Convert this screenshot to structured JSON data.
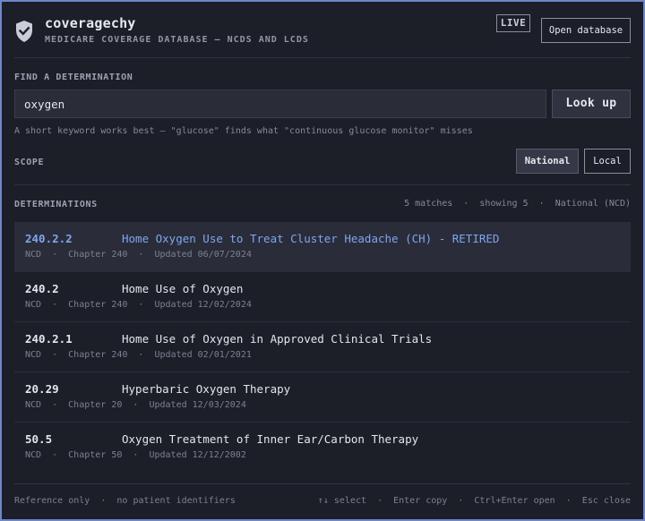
{
  "header": {
    "app_name": "coveragechy",
    "subtitle": "MEDICARE COVERAGE DATABASE — NCDS AND LCDS",
    "live_badge": "LIVE",
    "open_database_label": "Open database"
  },
  "search": {
    "section_label": "FIND A DETERMINATION",
    "query": "oxygen",
    "button_label": "Look up",
    "hint": "A short keyword works best — \"glucose\" finds what \"continuous glucose monitor\" misses"
  },
  "scope": {
    "label": "SCOPE",
    "options": [
      "National",
      "Local"
    ],
    "selected": "National"
  },
  "results": {
    "section_label": "DETERMINATIONS",
    "meta": "5 matches  ·  showing 5  ·  National (NCD)",
    "items": [
      {
        "id": "240.2.2",
        "title": "Home Oxygen Use to Treat Cluster Headache (CH) - RETIRED",
        "meta": "NCD  ·  Chapter 240  ·  Updated 06/07/2024",
        "selected": true
      },
      {
        "id": "240.2",
        "title": "Home Use of Oxygen",
        "meta": "NCD  ·  Chapter 240  ·  Updated 12/02/2024",
        "selected": false
      },
      {
        "id": "240.2.1",
        "title": "Home Use of Oxygen in Approved Clinical Trials",
        "meta": "NCD  ·  Chapter 240  ·  Updated 02/01/2021",
        "selected": false
      },
      {
        "id": "20.29",
        "title": "Hyperbaric Oxygen Therapy",
        "meta": "NCD  ·  Chapter 20  ·  Updated 12/03/2024",
        "selected": false
      },
      {
        "id": "50.5",
        "title": "Oxygen Treatment of Inner Ear/Carbon Therapy",
        "meta": "NCD  ·  Chapter 50  ·  Updated 12/12/2002",
        "selected": false
      }
    ]
  },
  "footer": {
    "left": "Reference only  ·  no patient identifiers",
    "right": "↑↓ select  ·  Enter copy  ·  Ctrl+Enter open  ·  Esc close"
  },
  "colors": {
    "accent": "#7ea6ef",
    "frame_border": "#6f86c9",
    "background": "#1c1e28"
  },
  "icons": {
    "logo": "shield-check-icon"
  }
}
